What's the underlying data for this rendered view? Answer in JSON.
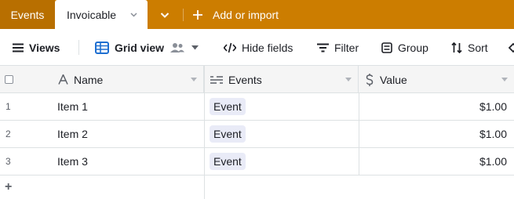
{
  "tabs": {
    "first": "Events",
    "active": "Invoicable",
    "add_import": "Add or import"
  },
  "toolbar": {
    "views": "Views",
    "grid_view": "Grid view",
    "hide_fields": "Hide fields",
    "filter": "Filter",
    "group": "Group",
    "sort": "Sort"
  },
  "columns": {
    "name": "Name",
    "events": "Events",
    "value": "Value"
  },
  "rows": [
    {
      "num": "1",
      "name": "Item 1",
      "event": "Event",
      "value": "$1.00"
    },
    {
      "num": "2",
      "name": "Item 2",
      "event": "Event",
      "value": "$1.00"
    },
    {
      "num": "3",
      "name": "Item 3",
      "event": "Event",
      "value": "$1.00"
    }
  ],
  "add_row": "+",
  "colors": {
    "tabbar": "#cc7d00",
    "accent_blue": "#1f6fd1",
    "pill": "#e9ebf7"
  }
}
